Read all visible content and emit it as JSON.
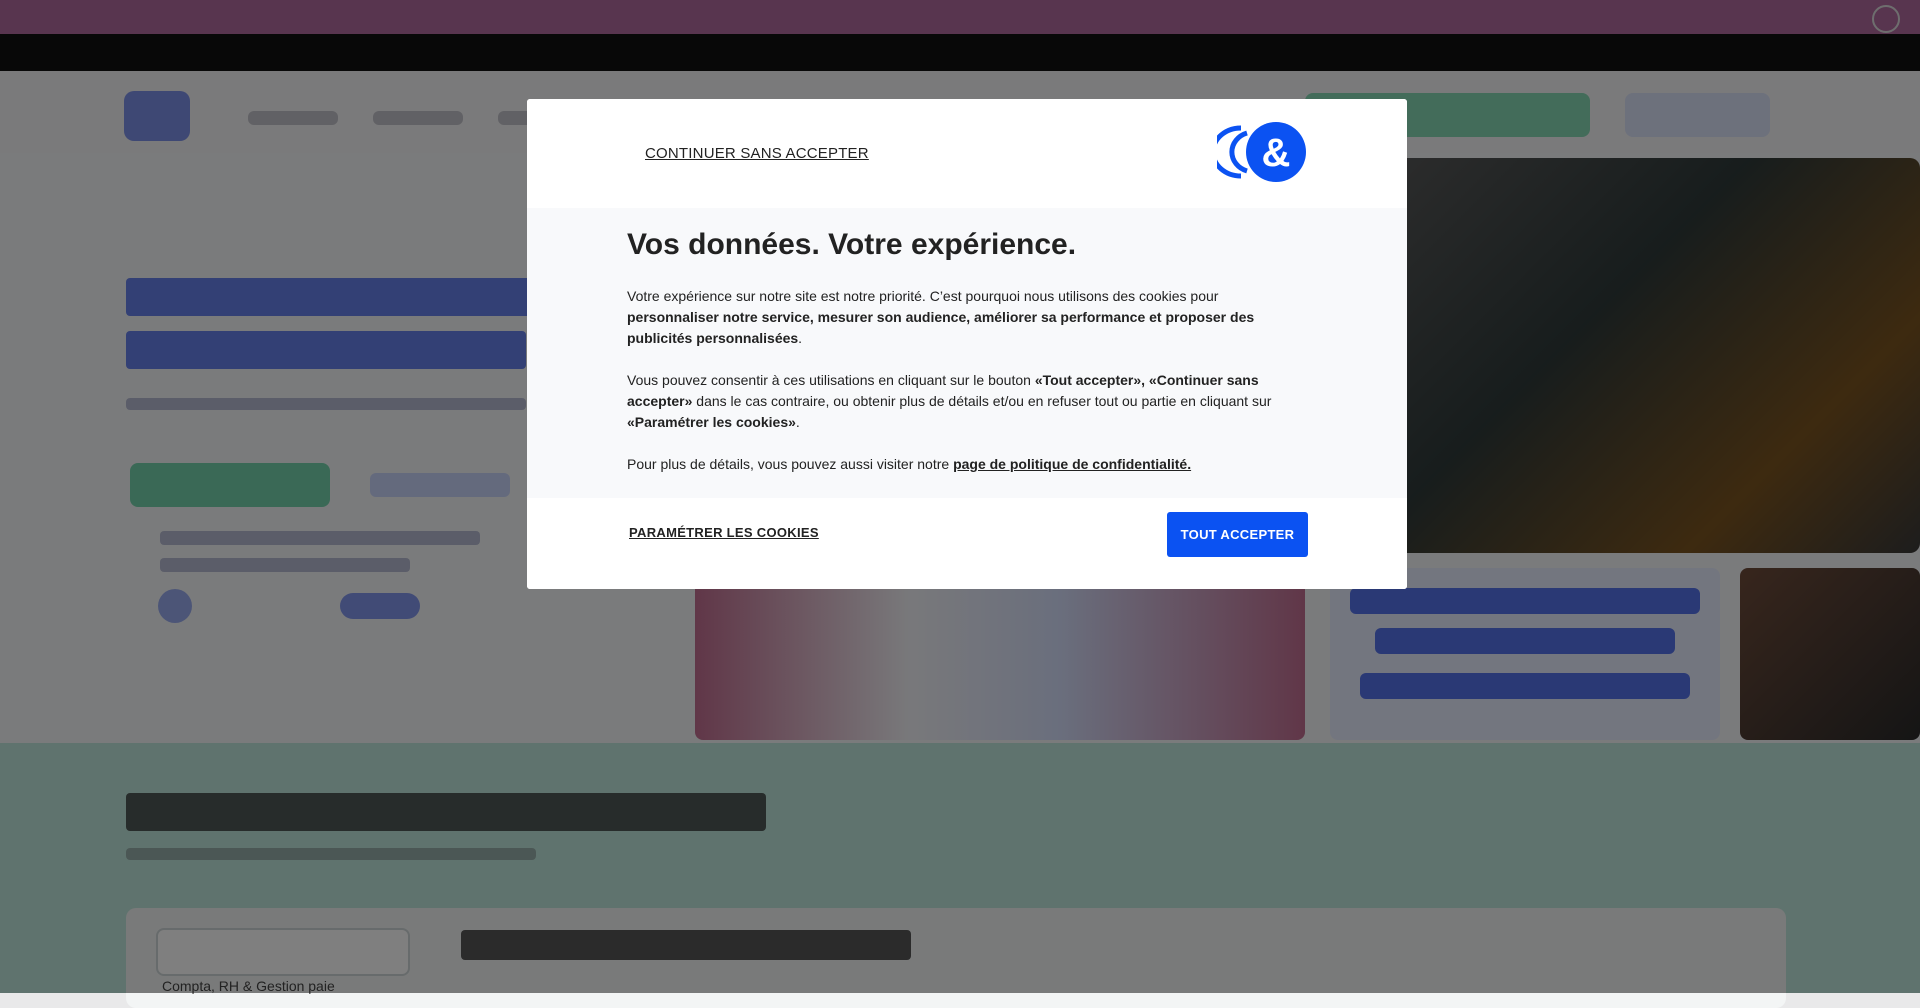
{
  "background_page": {
    "section_card_label": "Compta, RH & Gestion paie"
  },
  "consent": {
    "continue_without_accepting": "CONTINUER SANS ACCEPTER",
    "logo_glyph": "&",
    "title": "Vos données. Votre expérience.",
    "para1": {
      "text_before": "Votre expérience sur notre site est notre priorité. C’est pourquoi nous utilisons des cookies pour ",
      "bold": "personnaliser notre service, mesurer son audience, améliorer sa performance et proposer des publicités personnalisées",
      "text_after": "."
    },
    "para2": {
      "text_before": "Vous pouvez consentir à ces utilisations en cliquant sur le bouton ",
      "bold1": "«Tout accepter», «Continuer sans accepter»",
      "text_middle": " dans le cas contraire, ou obtenir plus de détails et/ou en refuser tout ou partie en cliquant sur ",
      "bold2": "«Paramétrer les cookies»",
      "text_after": "."
    },
    "para3": {
      "text_before": "Pour plus de détails, vous pouvez aussi visiter notre ",
      "link": "page de politique de confidentialité."
    },
    "configure_cookies": "PARAMÉTRER LES COOKIES",
    "accept_all": "TOUT ACCEPTER"
  },
  "colors": {
    "accent_blue": "#0b52f2",
    "text_dark": "#222222",
    "overlay": "rgba(0,0,0,0.50)"
  },
  "icons": {
    "brand_logo": "ampersand-logo-icon"
  }
}
